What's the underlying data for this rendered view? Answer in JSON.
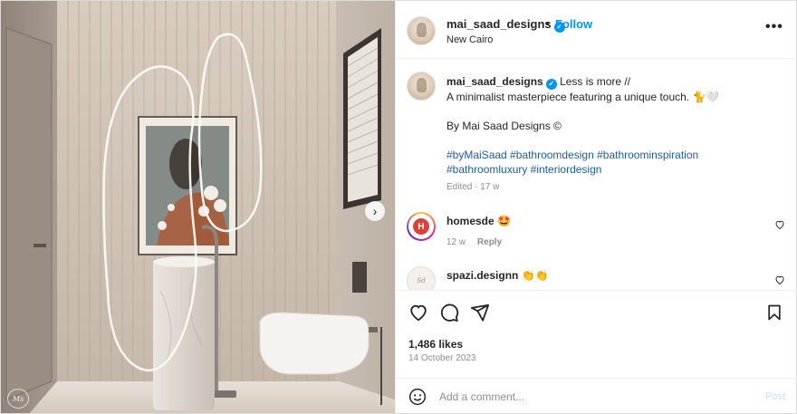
{
  "post": {
    "username": "mai_saad_designs",
    "verified": true,
    "separator": "•",
    "follow_label": "Follow",
    "location": "New Cairo",
    "more_label": "•••"
  },
  "caption": {
    "username": "mai_saad_designs",
    "line1": "Less is more //",
    "line2": "A minimalist masterpiece featuring a unique touch. 🐈🤍",
    "line3": "By Mai Saad Designs ©",
    "hashtags_line1": "#byMaiSaad #bathroomdesign #bathroominspiration",
    "hashtags_line2": "#bathroomluxury #interiordesign",
    "edited": "Edited · 17 w"
  },
  "comments": [
    {
      "username": "homesde",
      "text": "🤩",
      "age": "12 w",
      "reply_label": "Reply"
    },
    {
      "username": "spazi.designn",
      "text": "👏👏"
    }
  ],
  "stats": {
    "likes": "1,486 likes",
    "date": "14 October 2023"
  },
  "comment_box": {
    "placeholder": "Add a comment...",
    "post_label": "Post"
  },
  "icons": {
    "next": "chevron-right-icon",
    "like": "heart-icon",
    "comment": "comment-bubble-icon",
    "share": "paper-plane-icon",
    "save": "bookmark-icon",
    "emoji": "smiley-icon"
  },
  "colors": {
    "accent": "#0095f6",
    "hashtag": "#1a5ea8",
    "muted": "#8e8e8e"
  }
}
